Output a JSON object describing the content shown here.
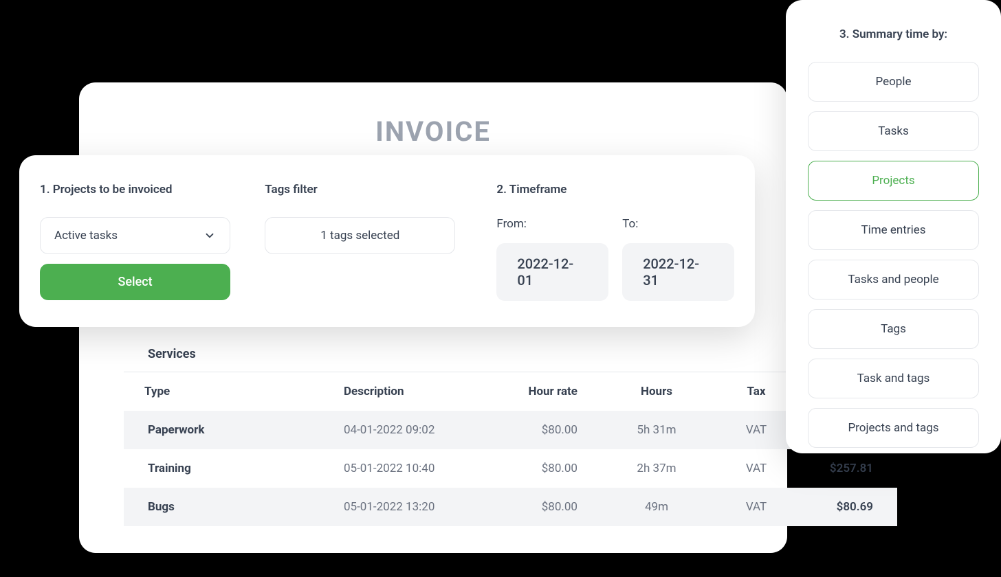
{
  "main": {
    "title": "INVOICE"
  },
  "filter": {
    "projects": {
      "label": "1. Projects to be invoiced",
      "dropdown_value": "Active tasks",
      "button_label": "Select"
    },
    "tags": {
      "label": "Tags filter",
      "value": "1 tags selected"
    },
    "timeframe": {
      "label": "2. Timeframe",
      "from_label": "From:",
      "to_label": "To:",
      "from_value": "2022-12-01",
      "to_value": "2022-12-31"
    }
  },
  "summary": {
    "title": "3. Summary time by:",
    "options": [
      {
        "label": "People",
        "active": false
      },
      {
        "label": "Tasks",
        "active": false
      },
      {
        "label": "Projects",
        "active": true
      },
      {
        "label": "Time entries",
        "active": false
      },
      {
        "label": "Tasks and people",
        "active": false
      },
      {
        "label": "Tags",
        "active": false
      },
      {
        "label": "Task and tags",
        "active": false
      },
      {
        "label": "Projects and tags",
        "active": false
      }
    ]
  },
  "services": {
    "heading": "Services",
    "columns": {
      "type": "Type",
      "description": "Description",
      "rate": "Hour rate",
      "hours": "Hours",
      "tax": "Tax",
      "total": ""
    },
    "rows": [
      {
        "type": "Paperwork",
        "description": "04-01-2022  09:02",
        "rate": "$80.00",
        "hours": "5h  31m",
        "tax": "VAT",
        "total": ""
      },
      {
        "type": "Training",
        "description": "05-01-2022  10:40",
        "rate": "$80.00",
        "hours": "2h  37m",
        "tax": "VAT",
        "total": "$257.81"
      },
      {
        "type": "Bugs",
        "description": "05-01-2022  13:20",
        "rate": "$80.00",
        "hours": "49m",
        "tax": "VAT",
        "total": "$80.69"
      }
    ]
  }
}
